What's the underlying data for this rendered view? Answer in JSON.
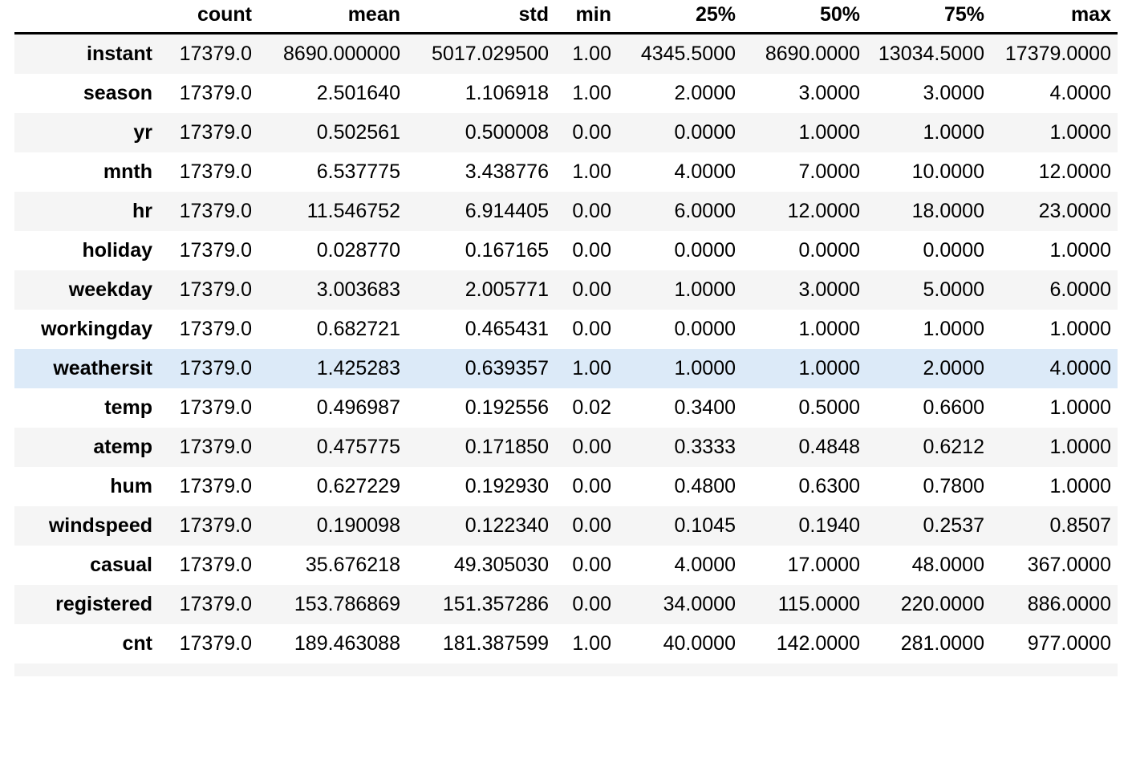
{
  "table": {
    "index_header": "",
    "columns": [
      "count",
      "mean",
      "std",
      "min",
      "25%",
      "50%",
      "75%",
      "max"
    ],
    "highlight_row": "weathersit",
    "highlight_color": "#dceaf8",
    "stripe_color": "#f5f5f5",
    "base_color": "#ffffff",
    "rows": [
      {
        "name": "instant",
        "values": [
          "17379.0",
          "8690.000000",
          "5017.029500",
          "1.00",
          "4345.5000",
          "8690.0000",
          "13034.5000",
          "17379.0000"
        ]
      },
      {
        "name": "season",
        "values": [
          "17379.0",
          "2.501640",
          "1.106918",
          "1.00",
          "2.0000",
          "3.0000",
          "3.0000",
          "4.0000"
        ]
      },
      {
        "name": "yr",
        "values": [
          "17379.0",
          "0.502561",
          "0.500008",
          "0.00",
          "0.0000",
          "1.0000",
          "1.0000",
          "1.0000"
        ]
      },
      {
        "name": "mnth",
        "values": [
          "17379.0",
          "6.537775",
          "3.438776",
          "1.00",
          "4.0000",
          "7.0000",
          "10.0000",
          "12.0000"
        ]
      },
      {
        "name": "hr",
        "values": [
          "17379.0",
          "11.546752",
          "6.914405",
          "0.00",
          "6.0000",
          "12.0000",
          "18.0000",
          "23.0000"
        ]
      },
      {
        "name": "holiday",
        "values": [
          "17379.0",
          "0.028770",
          "0.167165",
          "0.00",
          "0.0000",
          "0.0000",
          "0.0000",
          "1.0000"
        ]
      },
      {
        "name": "weekday",
        "values": [
          "17379.0",
          "3.003683",
          "2.005771",
          "0.00",
          "1.0000",
          "3.0000",
          "5.0000",
          "6.0000"
        ]
      },
      {
        "name": "workingday",
        "values": [
          "17379.0",
          "0.682721",
          "0.465431",
          "0.00",
          "0.0000",
          "1.0000",
          "1.0000",
          "1.0000"
        ]
      },
      {
        "name": "weathersit",
        "values": [
          "17379.0",
          "1.425283",
          "0.639357",
          "1.00",
          "1.0000",
          "1.0000",
          "2.0000",
          "4.0000"
        ]
      },
      {
        "name": "temp",
        "values": [
          "17379.0",
          "0.496987",
          "0.192556",
          "0.02",
          "0.3400",
          "0.5000",
          "0.6600",
          "1.0000"
        ]
      },
      {
        "name": "atemp",
        "values": [
          "17379.0",
          "0.475775",
          "0.171850",
          "0.00",
          "0.3333",
          "0.4848",
          "0.6212",
          "1.0000"
        ]
      },
      {
        "name": "hum",
        "values": [
          "17379.0",
          "0.627229",
          "0.192930",
          "0.00",
          "0.4800",
          "0.6300",
          "0.7800",
          "1.0000"
        ]
      },
      {
        "name": "windspeed",
        "values": [
          "17379.0",
          "0.190098",
          "0.122340",
          "0.00",
          "0.1045",
          "0.1940",
          "0.2537",
          "0.8507"
        ]
      },
      {
        "name": "casual",
        "values": [
          "17379.0",
          "35.676218",
          "49.305030",
          "0.00",
          "4.0000",
          "17.0000",
          "48.0000",
          "367.0000"
        ]
      },
      {
        "name": "registered",
        "values": [
          "17379.0",
          "153.786869",
          "151.357286",
          "0.00",
          "34.0000",
          "115.0000",
          "220.0000",
          "886.0000"
        ]
      },
      {
        "name": "cnt",
        "values": [
          "17379.0",
          "189.463088",
          "181.387599",
          "1.00",
          "40.0000",
          "142.0000",
          "281.0000",
          "977.0000"
        ]
      }
    ]
  }
}
